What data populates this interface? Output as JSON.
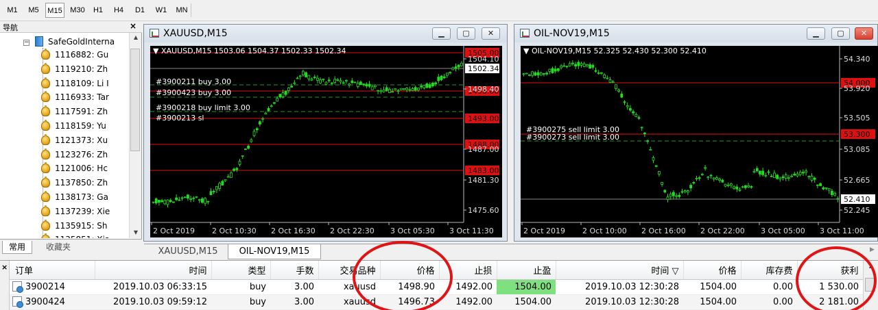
{
  "timeframes": [
    {
      "label": "M1",
      "active": false
    },
    {
      "label": "M5",
      "active": false
    },
    {
      "label": "M15",
      "active": true
    },
    {
      "label": "M30",
      "active": false
    },
    {
      "label": "H1",
      "active": false
    },
    {
      "label": "H4",
      "active": false
    },
    {
      "label": "D1",
      "active": false
    },
    {
      "label": "W1",
      "active": false
    },
    {
      "label": "MN",
      "active": false
    }
  ],
  "navigator": {
    "title": "导航",
    "close": "×",
    "root_label": "SafeGoldInterna",
    "accounts": [
      "1116882: Gu",
      "1119210: Zh",
      "1118109: Li I",
      "1116933: Tar",
      "1117591: Zh",
      "1118159: Yu",
      "1121373: Xu",
      "1123276: Zh",
      "1121006: Hc",
      "1137850: Zh",
      "1138173: Ga",
      "1137239: Xie",
      "1135915: Sh",
      "1135851: Xia"
    ],
    "tabs": [
      "常用",
      "收藏夹"
    ]
  },
  "chart1": {
    "title": "XAUUSD,M15",
    "info": "▼ XAUUSD,M15  1503.06 1504.37 1502.33 1502.34",
    "y_ticks": [
      "1504.10",
      "1498.40",
      "1487.00",
      "1481.30",
      "1475.60"
    ],
    "x_ticks": [
      "2 Oct 2019",
      "2 Oct 10:30",
      "2 Oct 16:30",
      "2 Oct 22:30",
      "3 Oct 05:30",
      "3 Oct 11:30"
    ],
    "current_price": "1502.34",
    "red_labels": [
      "1505.00",
      "1498.00",
      "1493.00",
      "1488.00",
      "1483.00"
    ],
    "order_labels": [
      "#3900211 buy 3.00",
      "#3900423 buy 3.00",
      "#3900218 buy limit 3.00",
      "#3900213 sl"
    ]
  },
  "chart2": {
    "title": "OIL-NOV19,M15",
    "info": "▼ OIL-NOV19,M15  52.325 52.430 52.300 52.410",
    "y_ticks": [
      "54.340",
      "53.920",
      "53.505",
      "53.085",
      "52.665",
      "52.245"
    ],
    "x_ticks": [
      "2 Oct 2019",
      "2 Oct 10:00",
      "2 Oct 16:00",
      "2 Oct 22:00",
      "3 Oct 05:00",
      "3 Oct 11:00"
    ],
    "current_price": "52.410",
    "red_labels": [
      "54.000",
      "53.300"
    ],
    "order_labels": [
      "#3900275 sell limit 3.00",
      "#3900273 sell limit 3.00"
    ]
  },
  "chart_tabs": [
    "XAUUSD,M15",
    "OIL-NOV19,M15"
  ],
  "terminal": {
    "close": "×",
    "columns": [
      "订单",
      "时间",
      "类型",
      "手数",
      "交易品种",
      "价格",
      "止损",
      "止盈",
      "时间 ▽",
      "价格",
      "库存费",
      "获利"
    ],
    "rows": [
      [
        "3900214",
        "2019.10.03 06:33:15",
        "buy",
        "3.00",
        "xauusd",
        "1498.90",
        "1492.00",
        "1504.00",
        "2019.10.03 12:30:28",
        "1504.00",
        "0.00",
        "1 530.00"
      ],
      [
        "3900424",
        "2019.10.03 09:59:12",
        "buy",
        "3.00",
        "xauusd",
        "1496.73",
        "1492.00",
        "1504.00",
        "2019.10.03 12:30:28",
        "1504.00",
        "0.00",
        "2 181.00"
      ]
    ]
  },
  "colors": {
    "bull_candle": "#22dd22",
    "level_line": "#e01010",
    "highlight_ring": "#e01414",
    "take_profit_cell": "#7fe07f"
  }
}
